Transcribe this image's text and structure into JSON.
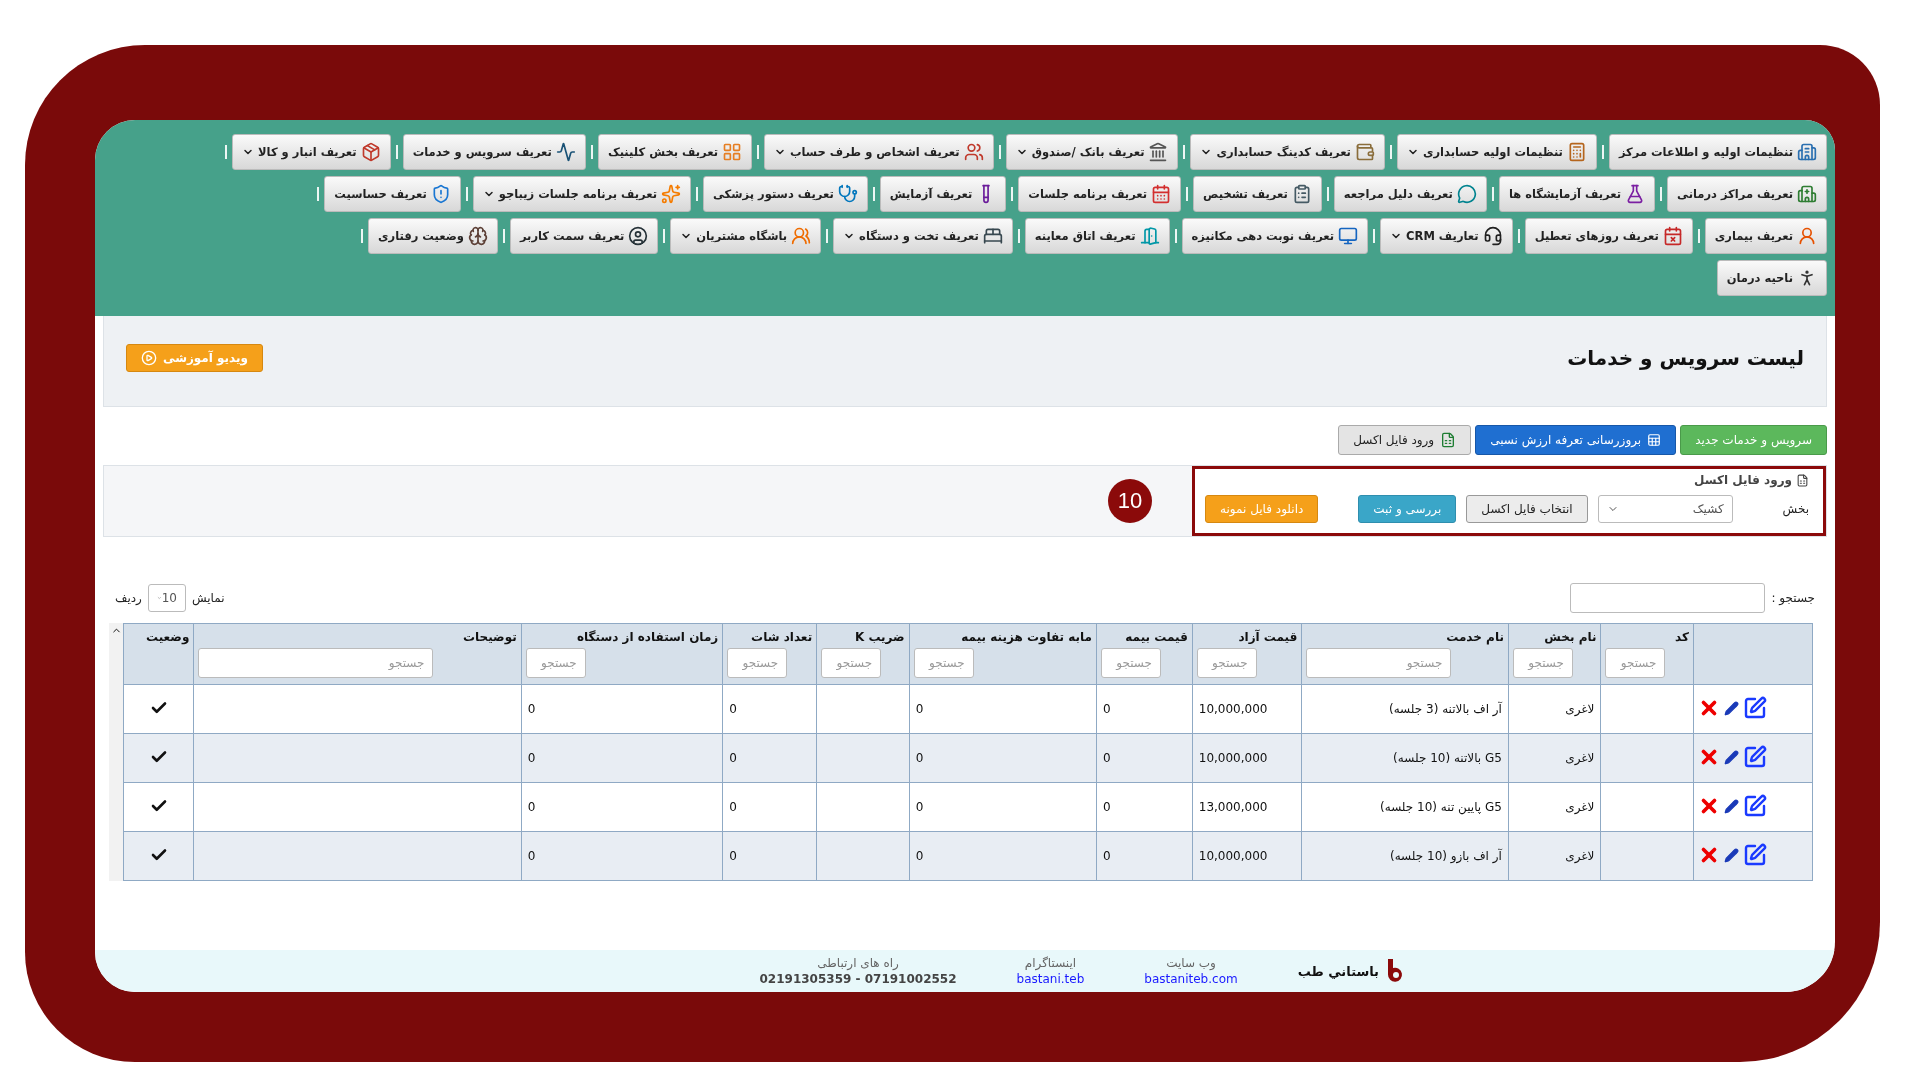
{
  "menu_rows": [
    [
      {
        "label": "تنظیمات اولیه و اطلاعات مرکز",
        "dropdown": false
      },
      {
        "label": "تنظیمات اولیه حسابداری",
        "dropdown": true
      },
      {
        "label": "تعریف کدینگ حسابداری",
        "dropdown": true
      },
      {
        "label": "تعریف بانک /صندوق",
        "dropdown": true
      },
      {
        "label": "تعریف اشخاص و طرف حساب",
        "dropdown": true
      },
      {
        "label": "تعریف بخش کلینیک",
        "dropdown": false
      },
      {
        "label": "تعریف سرویس و خدمات",
        "dropdown": false
      },
      {
        "label": "تعریف انبار و کالا",
        "dropdown": true
      }
    ],
    [
      {
        "label": "تعریف مراکز درمانی",
        "dropdown": false
      },
      {
        "label": "تعریف آزمایشگاه ها",
        "dropdown": false
      },
      {
        "label": "تعریف دلیل مراجعه",
        "dropdown": false
      },
      {
        "label": "تعریف تشخیص",
        "dropdown": false
      },
      {
        "label": "تعریف برنامه جلسات",
        "dropdown": false
      },
      {
        "label": "تعریف آزمایش",
        "dropdown": false
      },
      {
        "label": "تعریف دستور پزشکی",
        "dropdown": false
      },
      {
        "label": "تعریف برنامه جلسات زیباجو",
        "dropdown": true
      },
      {
        "label": "تعریف حساسیت",
        "dropdown": false
      }
    ],
    [
      {
        "label": "تعریف بیماری",
        "dropdown": false
      },
      {
        "label": "تعریف روزهای تعطیل",
        "dropdown": false
      },
      {
        "label": "تعاریف CRM",
        "dropdown": true
      },
      {
        "label": "تعریف نوبت دهی مکانیزه",
        "dropdown": false
      },
      {
        "label": "تعریف اتاق معاینه",
        "dropdown": false
      },
      {
        "label": "تعریف تخت و دستگاه",
        "dropdown": true
      },
      {
        "label": "باشگاه مشتریان",
        "dropdown": true
      },
      {
        "label": "تعریف سمت کاربر",
        "dropdown": false
      },
      {
        "label": "وضعیت رفتاری",
        "dropdown": false
      }
    ],
    [
      {
        "label": "ناحیه درمان",
        "dropdown": false
      }
    ]
  ],
  "page_title": "لیست سرویس و خدمات",
  "video_button": "ویدیو آموزشی",
  "action_buttons": [
    {
      "label": "سرویس و خدمات جدید",
      "kind": "success"
    },
    {
      "label": "بروزرسانی تعرفه ارزش نسبی",
      "kind": "primary"
    },
    {
      "label": "ورود فایل اکسل",
      "kind": "excel"
    }
  ],
  "excel_import": {
    "legend": "ورود فایل اکسل",
    "section_label": "بخش",
    "section_value": "کشیک",
    "buttons": [
      {
        "label": "انتخاب فایل اکسل",
        "kind": "default"
      },
      {
        "label": "بررسی و ثبت",
        "kind": "info"
      },
      {
        "label": "دانلود فایل نمونه",
        "kind": "warning"
      }
    ],
    "step_badge": "10"
  },
  "table_controls": {
    "search_label": "جستجو :",
    "show_label": "نمایش",
    "page_size": "10",
    "rows_label": "ردیف"
  },
  "table": {
    "columns": [
      {
        "label": "کد",
        "placeholder": "جستجو"
      },
      {
        "label": "نام بخش",
        "placeholder": "جستجو"
      },
      {
        "label": "نام خدمت",
        "placeholder": "جستجو"
      },
      {
        "label": "قیمت آزاد",
        "placeholder": "جستجو"
      },
      {
        "label": "قیمت بیمه",
        "placeholder": "جستجو"
      },
      {
        "label": "مابه تفاوت هزینه بیمه",
        "placeholder": "جستجو"
      },
      {
        "label": "ضریب K",
        "placeholder": "جستجو"
      },
      {
        "label": "تعداد شات",
        "placeholder": "جستجو"
      },
      {
        "label": "زمان استفاده از دستگاه",
        "placeholder": "جستجو"
      },
      {
        "label": "توضیحات",
        "placeholder": "جستجو"
      },
      {
        "label": "وضعیت"
      }
    ],
    "rows": [
      {
        "cells": [
          null,
          "لاغری",
          "آر اف بالاتنه (3 جلسه)",
          "10,000,000",
          "0",
          "0",
          null,
          "0",
          "0",
          null
        ],
        "active": true
      },
      {
        "cells": [
          null,
          "لاغری",
          "G5 بالاتنه (10 جلسه)",
          "10,000,000",
          "0",
          "0",
          null,
          "0",
          "0",
          null
        ],
        "active": true
      },
      {
        "cells": [
          null,
          "لاغری",
          "G5 پایین تنه (10 جلسه)",
          "13,000,000",
          "0",
          "0",
          null,
          "0",
          "0",
          null
        ],
        "active": true
      },
      {
        "cells": [
          null,
          "لاغری",
          "آر اف بازو (10 جلسه)",
          "10,000,000",
          "0",
          "0",
          null,
          "0",
          "0",
          null
        ],
        "active": true
      }
    ]
  },
  "footer": {
    "brand": "باستاني طب",
    "links": [
      {
        "caption": "وب سایت",
        "value": "bastaniteb.com",
        "link": true
      },
      {
        "caption": "اینستاگرام",
        "value": "bastani.teb",
        "link": true
      },
      {
        "caption": "راه های ارتباطی",
        "value": "07191002552 - 02191305359",
        "link": false
      }
    ]
  }
}
